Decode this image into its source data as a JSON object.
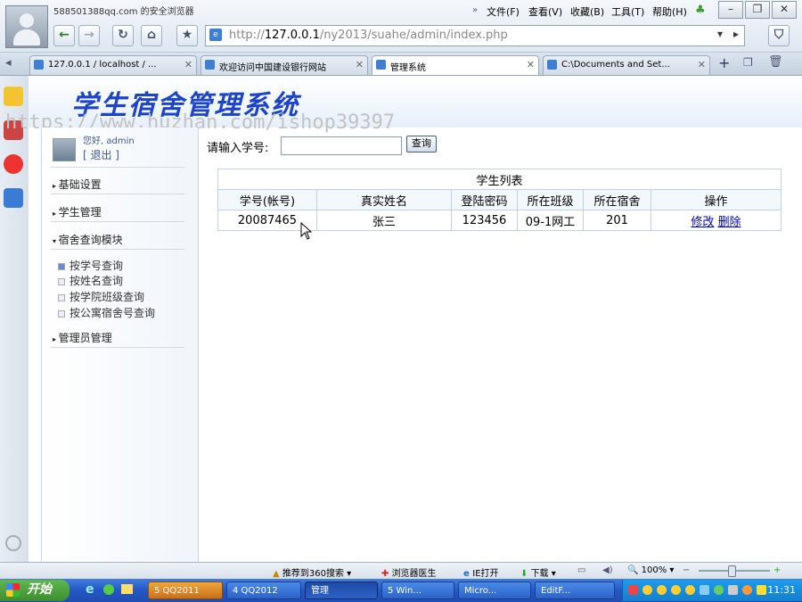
{
  "window": {
    "title": "588501388qq.com 的安全浏览器",
    "menu": [
      "文件(F)",
      "查看(V)",
      "收藏(B)",
      "工具(T)",
      "帮助(H)"
    ],
    "controls": [
      "–",
      "❐",
      "✕"
    ]
  },
  "address": {
    "prefix": "http://",
    "host": "127.0.0.1",
    "path": "/ny2013/suahe/admin/index.php"
  },
  "tabs": [
    {
      "label": "127.0.0.1 / localhost / ..."
    },
    {
      "label": "欢迎访问中国建设银行网站"
    },
    {
      "label": "管理系统"
    },
    {
      "label": "C:\\Documents and Set..."
    }
  ],
  "header": {
    "system_title": "学生宿舍管理系统",
    "watermark": "https://www.huzhan.com/ishop39397"
  },
  "user": {
    "greeting": "您好, admin",
    "logout": "[ 退出 ]"
  },
  "sidebar": {
    "sections": [
      {
        "label": "基础设置"
      },
      {
        "label": "学生管理"
      },
      {
        "label": "宿舍查询模块"
      },
      {
        "label": "管理员管理"
      }
    ],
    "sub_items": [
      {
        "label": "按学号查询"
      },
      {
        "label": "按姓名查询"
      },
      {
        "label": "按学院班级查询"
      },
      {
        "label": "按公寓宿舍号查询"
      }
    ]
  },
  "search": {
    "label": "请输入学号:",
    "value": "",
    "button": "查询"
  },
  "student_list": {
    "caption": "学生列表",
    "columns": [
      "学号(帐号)",
      "真实姓名",
      "登陆密码",
      "所在班级",
      "所在宿舍",
      "操作"
    ],
    "rows": [
      {
        "id": "20087465",
        "name": "张三",
        "password": "123456",
        "class": "09-1网工",
        "dorm": "201",
        "edit": "修改",
        "delete": "删除"
      }
    ]
  },
  "statusbar": {
    "recommend": "推荐到360搜索",
    "doctor": "浏览器医生",
    "ie_open": "IE打开",
    "download": "下载",
    "zoom": "100%"
  },
  "taskbar": {
    "start": "开始",
    "tasks": [
      "5 QQ2011",
      "4 QQ2012",
      "管理",
      "5 Win...",
      "Micro...",
      "EditF..."
    ],
    "clock": "11:31"
  }
}
